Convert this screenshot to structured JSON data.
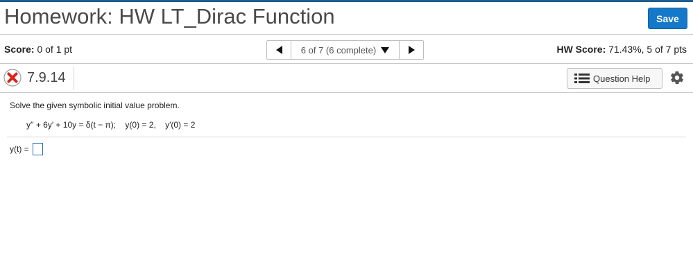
{
  "header": {
    "title": "Homework: HW LT_Dirac Function",
    "save_label": "Save"
  },
  "scorebar": {
    "score_label": "Score:",
    "score_value": "0 of 1 pt",
    "nav_text": "6 of 7 (6 complete)",
    "hw_score_label": "HW Score:",
    "hw_score_value": "71.43%, 5 of 7 pts"
  },
  "question": {
    "number": "7.9.14",
    "help_label": "Question Help",
    "status": "incorrect",
    "prompt": "Solve the given symbolic initial value problem.",
    "equation": "y′′ + 6y′ + 10y = δ(t − π);    y(0) = 2,    y′(0) = 2",
    "answer_label": "y(t) =",
    "answer_value": ""
  },
  "colors": {
    "accent": "#1678c8",
    "error": "#d9231c",
    "top_border": "#1f5e90"
  },
  "icons": {
    "status": "x-circle-icon",
    "help": "list-icon",
    "settings": "gear-icon",
    "prev": "triangle-left-icon",
    "next": "triangle-right-icon",
    "dropdown": "triangle-down-icon"
  }
}
